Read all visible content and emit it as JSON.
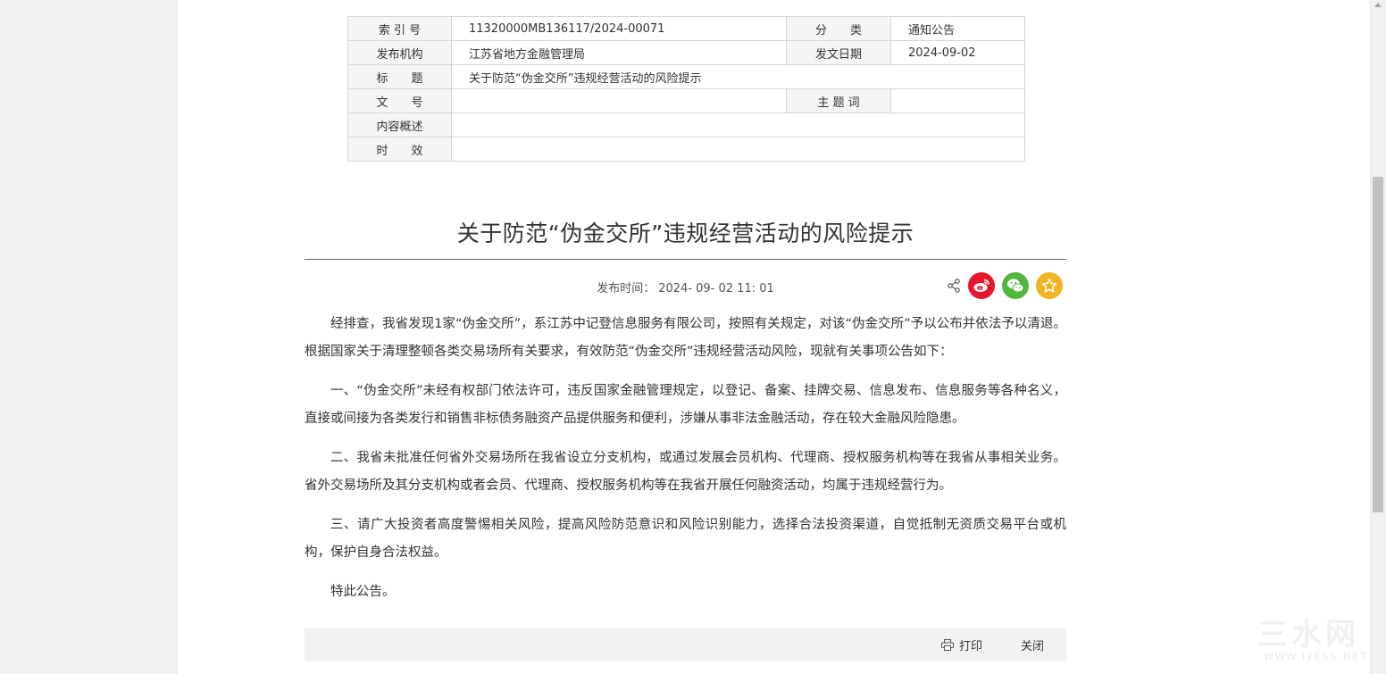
{
  "meta_table": {
    "index_label": "索 引 号",
    "index_value": "11320000MB136117/2024-00071",
    "category_label": "分　　类",
    "category_value": "通知公告",
    "publisher_label": "发布机构",
    "publisher_value": "江苏省地方金融管理局",
    "date_label": "发文日期",
    "date_value": "2024-09-02",
    "title_label": "标　　题",
    "title_value": "关于防范“伪金交所”违规经营活动的风险提示",
    "docno_label": "文　　号",
    "docno_value": "",
    "keyword_label": "主 题 词",
    "keyword_value": "",
    "summary_label": "内容概述",
    "summary_value": "",
    "validity_label": "时　　效",
    "validity_value": ""
  },
  "article": {
    "title": "关于防范“伪金交所”违规经营活动的风险提示",
    "pubtime_label": "发布时间：",
    "pubtime_value": "2024- 09- 02 11: 01",
    "paragraphs": [
      "经排查，我省发现1家“伪金交所”，系江苏中记登信息服务有限公司，按照有关规定，对该“伪金交所”予以公布并依法予以清退。根据国家关于清理整顿各类交易场所有关要求，有效防范“伪金交所”违规经营活动风险，现就有关事项公告如下：",
      "一、“伪金交所”未经有权部门依法许可，违反国家金融管理规定，以登记、备案、挂牌交易、信息发布、信息服务等各种名义，直接或间接为各类发行和销售非标债务融资产品提供服务和便利，涉嫌从事非法金融活动，存在较大金融风险隐患。",
      "二、我省未批准任何省外交易场所在我省设立分支机构，或通过发展会员机构、代理商、授权服务机构等在我省从事相关业务。省外交易场所及其分支机构或者会员、代理商、授权服务机构等在我省开展任何融资活动，均属于违规经营行为。",
      "三、请广大投资者高度警惕相关风险，提高风险防范意识和风险识别能力，选择合法投资渠道，自觉抵制无资质交易平台或机构，保护自身合法权益。",
      "特此公告。"
    ]
  },
  "share": {
    "icons": [
      "share-icon",
      "weibo-icon",
      "wechat-icon",
      "favorite-star-icon"
    ],
    "colors": {
      "weibo": "#e6162d",
      "wechat": "#52b53d",
      "favorite": "#f0b323"
    }
  },
  "footer": {
    "print_label": "打印",
    "close_label": "关闭"
  },
  "watermark": {
    "big": "三水网",
    "small": "WWW.IYESS.NET"
  }
}
